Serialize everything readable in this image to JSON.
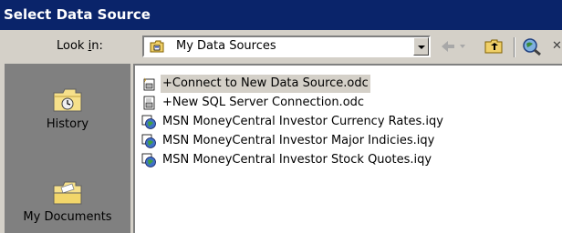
{
  "window": {
    "title": "Select Data Source"
  },
  "lookin": {
    "label_pre": "Look ",
    "label_key": "i",
    "label_post": "n:",
    "value": "My Data Sources"
  },
  "places": [
    {
      "label": "History",
      "icon": "history-folder-icon"
    },
    {
      "label": "My Documents",
      "icon": "my-documents-folder-icon"
    }
  ],
  "files": [
    {
      "name": "+Connect to New Data Source.odc",
      "icon": "new-connection-file-icon",
      "selected": true
    },
    {
      "name": "+New SQL Server Connection.odc",
      "icon": "odc-file-icon",
      "selected": false
    },
    {
      "name": "MSN MoneyCentral Investor Currency Rates.iqy",
      "icon": "web-query-icon",
      "selected": false
    },
    {
      "name": "MSN MoneyCentral Investor Major Indicies.iqy",
      "icon": "web-query-icon",
      "selected": false
    },
    {
      "name": "MSN MoneyCentral Investor Stock Quotes.iqy",
      "icon": "web-query-icon",
      "selected": false
    }
  ],
  "colors": {
    "titlebar": "#0a246a",
    "face": "#d4d0c8",
    "places_bg": "#808080",
    "selection": "#d4d0c8"
  }
}
